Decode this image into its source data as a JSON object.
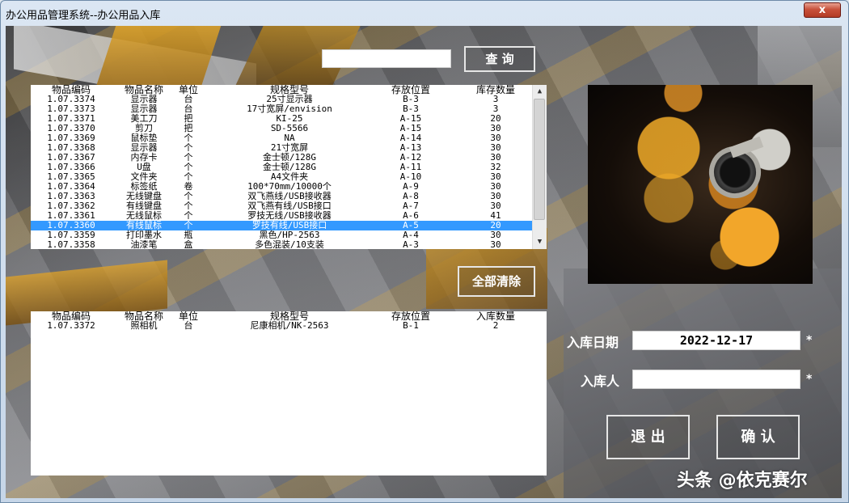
{
  "window": {
    "title": "办公用品管理系统--办公用品入库",
    "close_label": "x"
  },
  "search": {
    "value": "",
    "button_label": "查 询"
  },
  "inventory_list": {
    "headers": [
      "物品编码",
      "物品名称",
      "单位",
      "规格型号",
      "存放位置",
      "库存数量"
    ],
    "rows": [
      [
        "1.07.3374",
        "显示器",
        "台",
        "25寸显示器",
        "B-3",
        "3"
      ],
      [
        "1.07.3373",
        "显示器",
        "台",
        "17寸宽屏/envision",
        "B-3",
        "3"
      ],
      [
        "1.07.3371",
        "美工刀",
        "把",
        "KI-25",
        "A-15",
        "20"
      ],
      [
        "1.07.3370",
        "剪刀",
        "把",
        "SD-5566",
        "A-15",
        "30"
      ],
      [
        "1.07.3369",
        "鼠标垫",
        "个",
        "NA",
        "A-14",
        "30"
      ],
      [
        "1.07.3368",
        "显示器",
        "个",
        "21寸宽屏",
        "A-13",
        "30"
      ],
      [
        "1.07.3367",
        "内存卡",
        "个",
        "金士顿/128G",
        "A-12",
        "30"
      ],
      [
        "1.07.3366",
        "U盘",
        "个",
        "金士顿/128G",
        "A-11",
        "32"
      ],
      [
        "1.07.3365",
        "文件夹",
        "个",
        "A4文件夹",
        "A-10",
        "30"
      ],
      [
        "1.07.3364",
        "标签纸",
        "卷",
        "100*70mm/10000个",
        "A-9",
        "30"
      ],
      [
        "1.07.3363",
        "无线键盘",
        "个",
        "双飞燕线/USB接收器",
        "A-8",
        "30"
      ],
      [
        "1.07.3362",
        "有线键盘",
        "个",
        "双飞燕有线/USB接口",
        "A-7",
        "30"
      ],
      [
        "1.07.3361",
        "无线鼠标",
        "个",
        "罗技无线/USB接收器",
        "A-6",
        "41"
      ],
      [
        "1.07.3360",
        "有线鼠标",
        "个",
        "罗技有线/USB接口",
        "A-5",
        "20"
      ],
      [
        "1.07.3359",
        "打印墨水",
        "瓶",
        "黑色/HP-2563",
        "A-4",
        "30"
      ],
      [
        "1.07.3358",
        "油漆笔",
        "盒",
        "多色混装/10支装",
        "A-3",
        "30"
      ]
    ],
    "selected_index": 13
  },
  "clear_all_label": "全部清除",
  "entry_list": {
    "headers": [
      "物品编码",
      "物品名称",
      "单位",
      "规格型号",
      "存放位置",
      "入库数量"
    ],
    "rows": [
      [
        "1.07.3372",
        "照相机",
        "台",
        "尼康相机/NK-2563",
        "B-1",
        "2"
      ]
    ]
  },
  "form": {
    "date_label": "入库日期",
    "date_value": "2022-12-17",
    "person_label": "入库人",
    "person_value": "",
    "required_mark": "*"
  },
  "buttons": {
    "exit_label": "退 出",
    "confirm_label": "确 认"
  },
  "watermark": "头条 @依克赛尔"
}
